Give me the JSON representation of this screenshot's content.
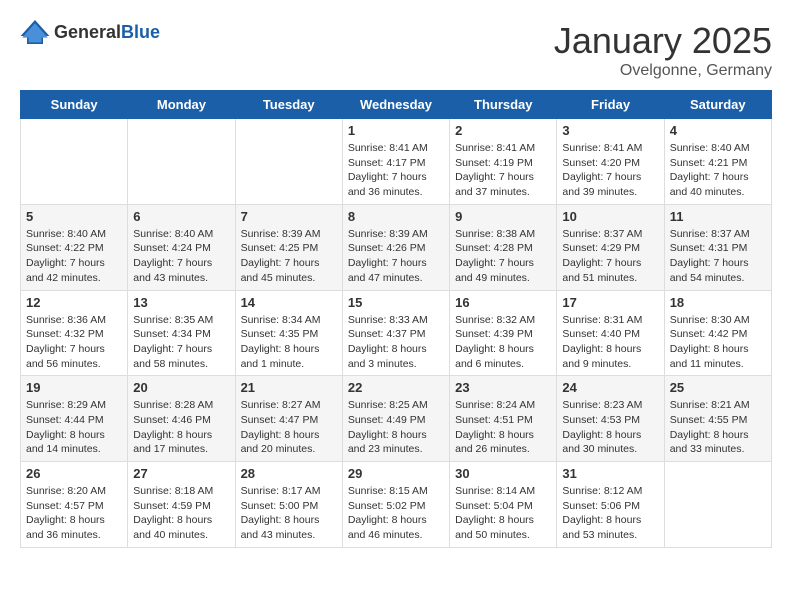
{
  "logo": {
    "general": "General",
    "blue": "Blue"
  },
  "title": "January 2025",
  "subtitle": "Ovelgonne, Germany",
  "weekdays": [
    "Sunday",
    "Monday",
    "Tuesday",
    "Wednesday",
    "Thursday",
    "Friday",
    "Saturday"
  ],
  "weeks": [
    [
      {
        "day": "",
        "info": ""
      },
      {
        "day": "",
        "info": ""
      },
      {
        "day": "",
        "info": ""
      },
      {
        "day": "1",
        "info": "Sunrise: 8:41 AM\nSunset: 4:17 PM\nDaylight: 7 hours\nand 36 minutes."
      },
      {
        "day": "2",
        "info": "Sunrise: 8:41 AM\nSunset: 4:19 PM\nDaylight: 7 hours\nand 37 minutes."
      },
      {
        "day": "3",
        "info": "Sunrise: 8:41 AM\nSunset: 4:20 PM\nDaylight: 7 hours\nand 39 minutes."
      },
      {
        "day": "4",
        "info": "Sunrise: 8:40 AM\nSunset: 4:21 PM\nDaylight: 7 hours\nand 40 minutes."
      }
    ],
    [
      {
        "day": "5",
        "info": "Sunrise: 8:40 AM\nSunset: 4:22 PM\nDaylight: 7 hours\nand 42 minutes."
      },
      {
        "day": "6",
        "info": "Sunrise: 8:40 AM\nSunset: 4:24 PM\nDaylight: 7 hours\nand 43 minutes."
      },
      {
        "day": "7",
        "info": "Sunrise: 8:39 AM\nSunset: 4:25 PM\nDaylight: 7 hours\nand 45 minutes."
      },
      {
        "day": "8",
        "info": "Sunrise: 8:39 AM\nSunset: 4:26 PM\nDaylight: 7 hours\nand 47 minutes."
      },
      {
        "day": "9",
        "info": "Sunrise: 8:38 AM\nSunset: 4:28 PM\nDaylight: 7 hours\nand 49 minutes."
      },
      {
        "day": "10",
        "info": "Sunrise: 8:37 AM\nSunset: 4:29 PM\nDaylight: 7 hours\nand 51 minutes."
      },
      {
        "day": "11",
        "info": "Sunrise: 8:37 AM\nSunset: 4:31 PM\nDaylight: 7 hours\nand 54 minutes."
      }
    ],
    [
      {
        "day": "12",
        "info": "Sunrise: 8:36 AM\nSunset: 4:32 PM\nDaylight: 7 hours\nand 56 minutes."
      },
      {
        "day": "13",
        "info": "Sunrise: 8:35 AM\nSunset: 4:34 PM\nDaylight: 7 hours\nand 58 minutes."
      },
      {
        "day": "14",
        "info": "Sunrise: 8:34 AM\nSunset: 4:35 PM\nDaylight: 8 hours\nand 1 minute."
      },
      {
        "day": "15",
        "info": "Sunrise: 8:33 AM\nSunset: 4:37 PM\nDaylight: 8 hours\nand 3 minutes."
      },
      {
        "day": "16",
        "info": "Sunrise: 8:32 AM\nSunset: 4:39 PM\nDaylight: 8 hours\nand 6 minutes."
      },
      {
        "day": "17",
        "info": "Sunrise: 8:31 AM\nSunset: 4:40 PM\nDaylight: 8 hours\nand 9 minutes."
      },
      {
        "day": "18",
        "info": "Sunrise: 8:30 AM\nSunset: 4:42 PM\nDaylight: 8 hours\nand 11 minutes."
      }
    ],
    [
      {
        "day": "19",
        "info": "Sunrise: 8:29 AM\nSunset: 4:44 PM\nDaylight: 8 hours\nand 14 minutes."
      },
      {
        "day": "20",
        "info": "Sunrise: 8:28 AM\nSunset: 4:46 PM\nDaylight: 8 hours\nand 17 minutes."
      },
      {
        "day": "21",
        "info": "Sunrise: 8:27 AM\nSunset: 4:47 PM\nDaylight: 8 hours\nand 20 minutes."
      },
      {
        "day": "22",
        "info": "Sunrise: 8:25 AM\nSunset: 4:49 PM\nDaylight: 8 hours\nand 23 minutes."
      },
      {
        "day": "23",
        "info": "Sunrise: 8:24 AM\nSunset: 4:51 PM\nDaylight: 8 hours\nand 26 minutes."
      },
      {
        "day": "24",
        "info": "Sunrise: 8:23 AM\nSunset: 4:53 PM\nDaylight: 8 hours\nand 30 minutes."
      },
      {
        "day": "25",
        "info": "Sunrise: 8:21 AM\nSunset: 4:55 PM\nDaylight: 8 hours\nand 33 minutes."
      }
    ],
    [
      {
        "day": "26",
        "info": "Sunrise: 8:20 AM\nSunset: 4:57 PM\nDaylight: 8 hours\nand 36 minutes."
      },
      {
        "day": "27",
        "info": "Sunrise: 8:18 AM\nSunset: 4:59 PM\nDaylight: 8 hours\nand 40 minutes."
      },
      {
        "day": "28",
        "info": "Sunrise: 8:17 AM\nSunset: 5:00 PM\nDaylight: 8 hours\nand 43 minutes."
      },
      {
        "day": "29",
        "info": "Sunrise: 8:15 AM\nSunset: 5:02 PM\nDaylight: 8 hours\nand 46 minutes."
      },
      {
        "day": "30",
        "info": "Sunrise: 8:14 AM\nSunset: 5:04 PM\nDaylight: 8 hours\nand 50 minutes."
      },
      {
        "day": "31",
        "info": "Sunrise: 8:12 AM\nSunset: 5:06 PM\nDaylight: 8 hours\nand 53 minutes."
      },
      {
        "day": "",
        "info": ""
      }
    ]
  ]
}
